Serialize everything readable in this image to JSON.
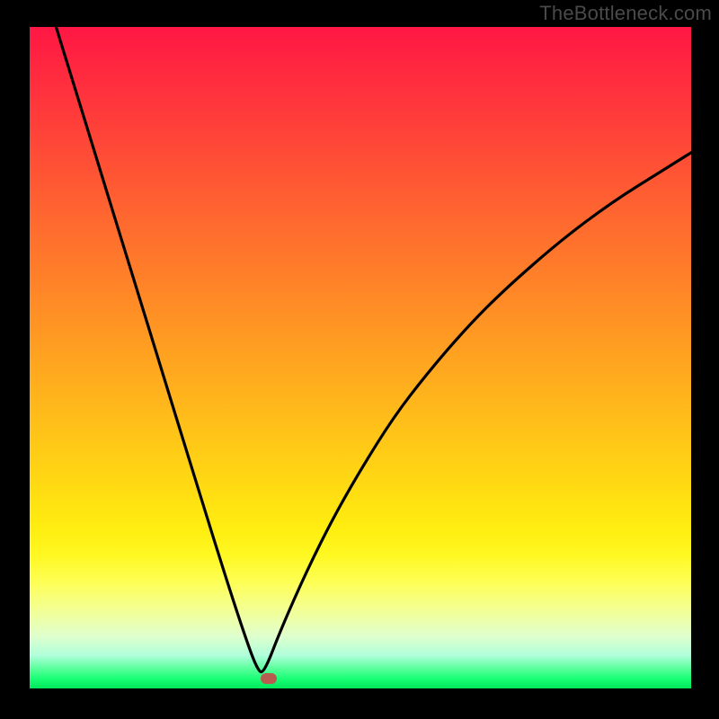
{
  "watermark": "TheBottleneck.com",
  "chart_data": {
    "type": "line",
    "title": "",
    "xlabel": "",
    "ylabel": "",
    "x_range_fraction": [
      0,
      1
    ],
    "y_range_fraction": [
      0,
      1
    ],
    "marker_position_fraction": {
      "x": 0.362,
      "y": 0.985
    },
    "series": [
      {
        "name": "bottleneck-curve",
        "description": "V-shaped curve starting at top-left, descending steeply to a minimum near the bottom around x≈0.35, then rising with decreasing slope toward the upper-right.",
        "x": [
          0.04,
          0.08,
          0.12,
          0.16,
          0.2,
          0.24,
          0.28,
          0.32,
          0.345,
          0.355,
          0.38,
          0.42,
          0.46,
          0.5,
          0.55,
          0.6,
          0.66,
          0.72,
          0.8,
          0.88,
          0.96,
          1.0
        ],
        "y": [
          0.0,
          0.13,
          0.26,
          0.39,
          0.52,
          0.65,
          0.78,
          0.905,
          0.975,
          0.975,
          0.91,
          0.82,
          0.74,
          0.67,
          0.59,
          0.525,
          0.455,
          0.395,
          0.325,
          0.265,
          0.215,
          0.19
        ]
      }
    ],
    "background_gradient": {
      "top_color": "#ff1744",
      "mid_color": "#ffee10",
      "bottom_color": "#00e85a"
    }
  }
}
